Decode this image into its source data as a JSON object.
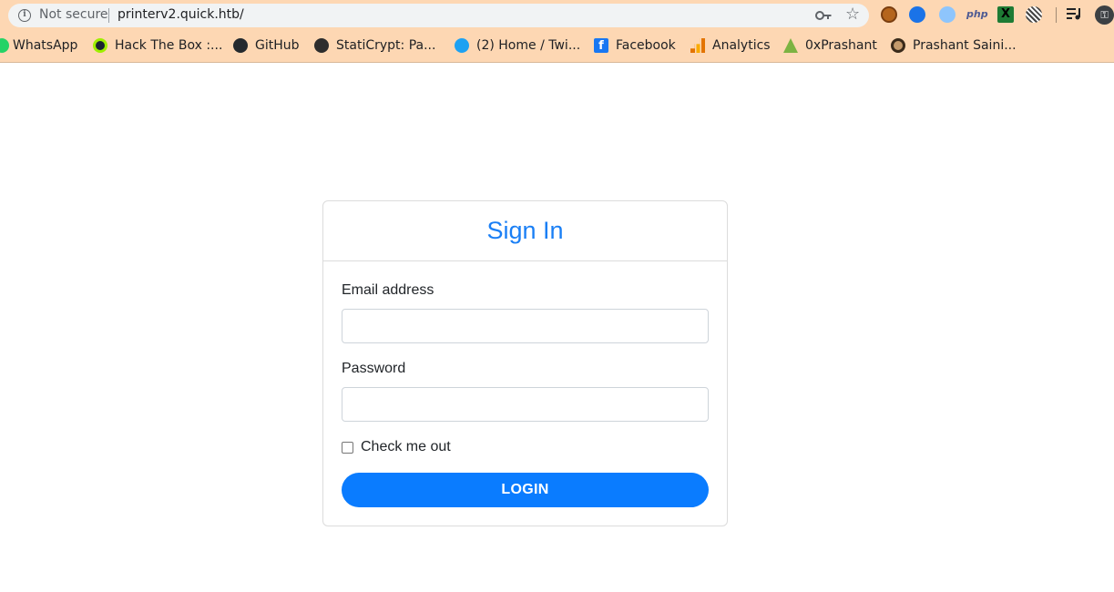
{
  "browser": {
    "security_text": "Not secure",
    "url": "printerv2.quick.htb/",
    "bookmarks": [
      {
        "label": "WhatsApp",
        "icon": "whatsapp-icon"
      },
      {
        "label": "Hack The Box :...",
        "icon": "hackthebox-icon"
      },
      {
        "label": "GitHub",
        "icon": "github-icon"
      },
      {
        "label": "StatiCrypt: Pa...",
        "icon": "globe-icon"
      },
      {
        "label": "(2) Home / Twi...",
        "icon": "twitter-icon"
      },
      {
        "label": "Facebook",
        "icon": "facebook-icon"
      },
      {
        "label": "Analytics",
        "icon": "analytics-icon"
      },
      {
        "label": "0xPrashant",
        "icon": "0xprashant-icon"
      },
      {
        "label": "Prashant Saini...",
        "icon": "prashant-avatar-icon"
      }
    ],
    "extensions": [
      "cookie-icon",
      "blue-extension-icon",
      "wave-extension-icon",
      "php-icon",
      "x-extension-icon",
      "stripes-extension-icon",
      "media-icon"
    ],
    "php_text": "php",
    "facebook_glyph": "f",
    "x_glyph": "X"
  },
  "login": {
    "title": "Sign In",
    "email_label": "Email address",
    "email_value": "",
    "password_label": "Password",
    "password_value": "",
    "remember_label": "Check me out",
    "remember_checked": false,
    "submit_label": "LOGIN"
  },
  "colors": {
    "chrome_bg": "#fdd7b3",
    "accent": "#0a7cff",
    "title": "#1a7ff5"
  }
}
